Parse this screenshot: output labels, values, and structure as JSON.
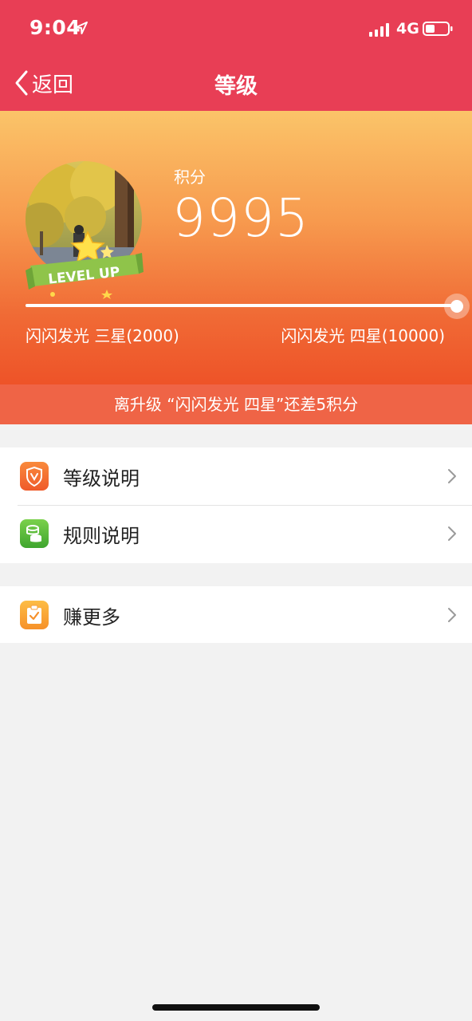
{
  "status_bar": {
    "time": "9:04",
    "network": "4G"
  },
  "nav": {
    "back_label": "返回",
    "title": "等级"
  },
  "hero": {
    "points_label": "积分",
    "points_value": "9995",
    "badge_text": "LEVEL UP",
    "progress_fraction": 0.9994,
    "current_level": "闪闪发光 三星(2000)",
    "next_level": "闪闪发光 四星(10000)"
  },
  "hint": "离升级 “闪闪发光 四星”还差5积分",
  "menu": [
    {
      "label": "等级说明",
      "icon": "shield-v-icon"
    },
    {
      "label": "规则说明",
      "icon": "coins-icon"
    }
  ],
  "menu2": [
    {
      "label": "赚更多",
      "icon": "clipboard-check-icon"
    }
  ],
  "colors": {
    "header": "#e83e55",
    "hero_top": "#fbc469",
    "hero_bottom": "#ee5328",
    "hint_bar": "#ef6446"
  }
}
